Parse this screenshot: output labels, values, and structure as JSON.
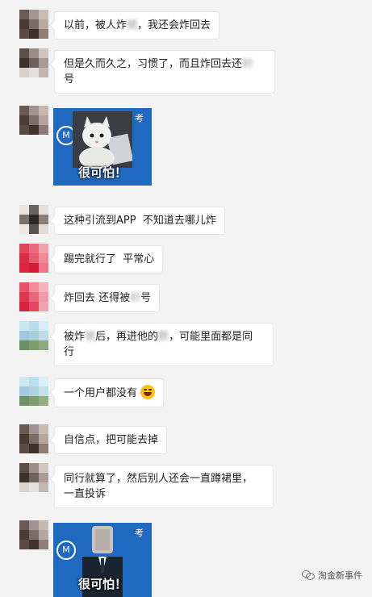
{
  "messages": [
    {
      "type": "text",
      "text": "以前，被人炸",
      "blur": "號",
      "after": "，我还会炸回去"
    },
    {
      "type": "text",
      "text": "但是久而久之，习惯了，而且炸回去还",
      "blur": "封",
      "after": "\n号"
    },
    {
      "type": "sticker",
      "label": "考",
      "caption": "很可怕！"
    },
    {
      "type": "text",
      "text": "这种引流到APP  不知道去哪儿炸"
    },
    {
      "type": "text",
      "text": "踢完就行了  平常心"
    },
    {
      "type": "text",
      "text": "炸回去 还得被",
      "blur": "封",
      "after": "号"
    },
    {
      "type": "text",
      "text": "被炸",
      "blur": "號",
      "after": "后，再进他的",
      "blur2": "群",
      "after2": "，可能里面都是同\n行"
    },
    {
      "type": "text",
      "text": "一个用户都没有",
      "emoji": "laughing-emoji"
    },
    {
      "type": "text",
      "text": "自信点，把可能去掉"
    },
    {
      "type": "text",
      "text": "同行就算了，然后别人还会一直蹲裙里，\n一直投诉"
    },
    {
      "type": "sticker",
      "label": "考",
      "caption": "很可怕！"
    }
  ],
  "watermark": {
    "text": "淘金新事件"
  }
}
